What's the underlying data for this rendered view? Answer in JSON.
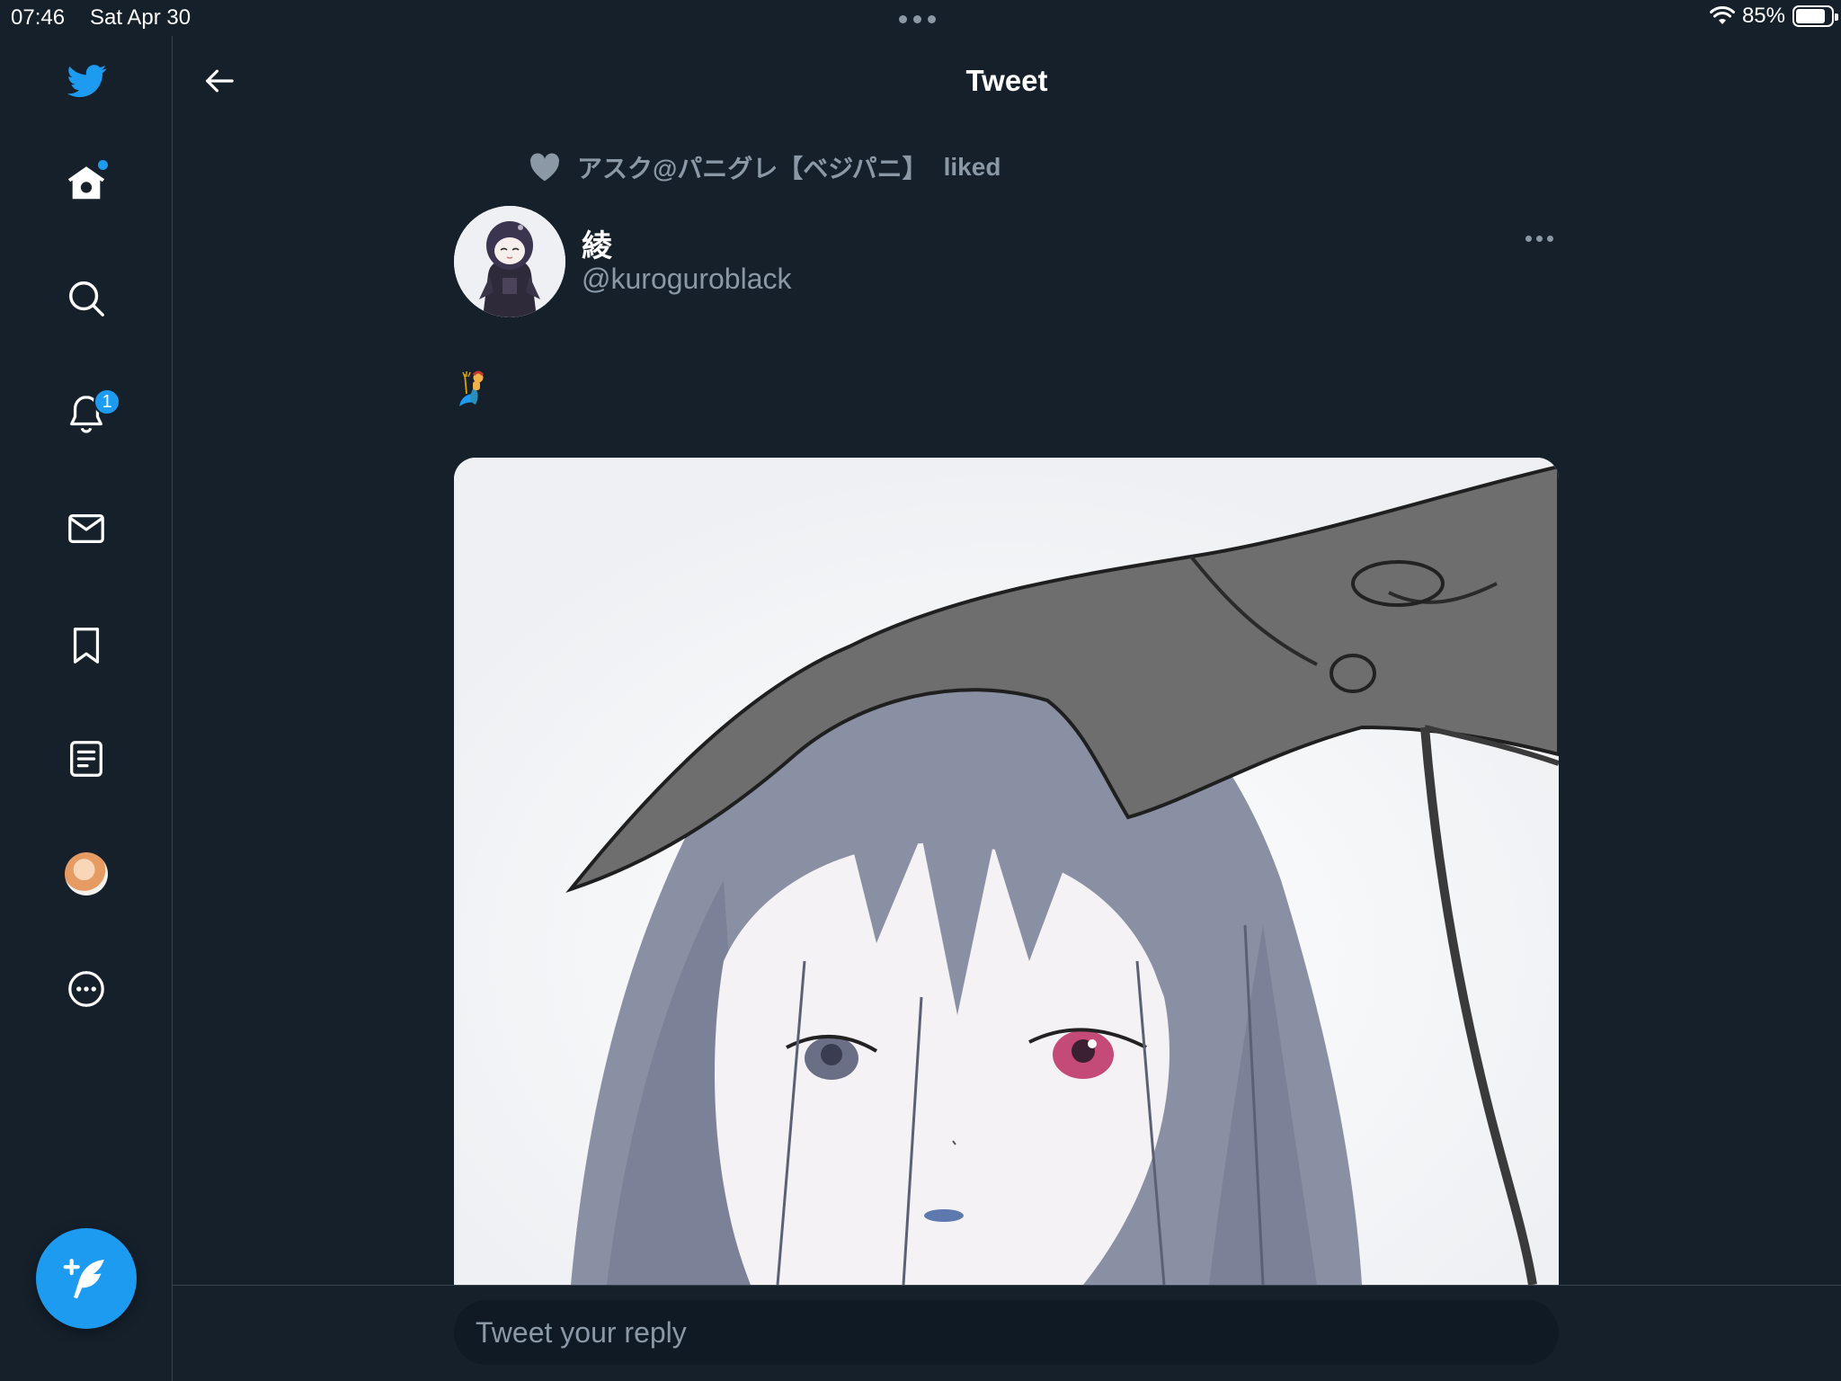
{
  "status_bar": {
    "time": "07:46",
    "date": "Sat Apr 30",
    "battery": "85%",
    "battery_level": 0.85,
    "wifi_icon": "wifi-icon"
  },
  "sidebar": {
    "logo_icon": "twitter-bird-icon",
    "items": [
      {
        "icon": "home-icon",
        "has_dot": true
      },
      {
        "icon": "search-icon"
      },
      {
        "icon": "bell-icon",
        "badge": "1"
      },
      {
        "icon": "mail-icon"
      },
      {
        "icon": "bookmark-icon"
      },
      {
        "icon": "lists-icon"
      },
      {
        "icon": "profile-avatar"
      },
      {
        "icon": "more-circle-icon"
      }
    ],
    "compose_icon": "compose-feather-icon"
  },
  "header": {
    "title": "Tweet",
    "back_icon": "arrow-left-icon"
  },
  "tweet": {
    "social_context": {
      "icon": "heart-icon",
      "user": "アスク@パニグレ【ベジパニ】",
      "action": "liked"
    },
    "author": {
      "name": "綾",
      "handle": "@kuroguroblack"
    },
    "content_emoji": "🧜‍♀️"
  },
  "reply": {
    "placeholder": "Tweet your reply"
  },
  "colors": {
    "background": "#15202b",
    "accent": "#1d9bf0",
    "secondary_text": "#8b98a5",
    "divider": "#38444d"
  }
}
